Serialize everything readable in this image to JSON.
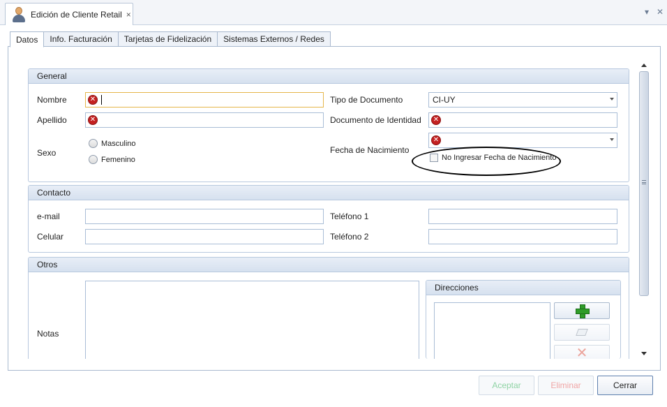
{
  "document_tab": {
    "title": "Edición de Cliente Retail",
    "close_glyph": "×"
  },
  "window_controls": {
    "dropdown_glyph": "▾",
    "close_glyph": "✕"
  },
  "tabs": [
    {
      "label": "Datos",
      "active": true
    },
    {
      "label": "Info. Facturación",
      "active": false
    },
    {
      "label": "Tarjetas de Fidelización",
      "active": false
    },
    {
      "label": "Sistemas Externos / Redes",
      "active": false
    }
  ],
  "general": {
    "header": "General",
    "nombre_label": "Nombre",
    "nombre_value": "",
    "apellido_label": "Apellido",
    "apellido_value": "",
    "sexo_label": "Sexo",
    "sexo_options": [
      "Masculino",
      "Femenino"
    ],
    "tipo_doc_label": "Tipo de Documento",
    "tipo_doc_value": "CI-UY",
    "doc_id_label": "Documento de Identidad",
    "doc_id_value": "",
    "fecha_nac_label": "Fecha de Nacimiento",
    "fecha_nac_value": "",
    "no_fecha_label": "No Ingresar Fecha de Nacimiento",
    "no_fecha_checked": false,
    "error_glyph": "✕"
  },
  "contacto": {
    "header": "Contacto",
    "email_label": "e-mail",
    "celular_label": "Celular",
    "telefono1_label": "Teléfono 1",
    "telefono2_label": "Teléfono 2"
  },
  "otros": {
    "header": "Otros",
    "notas_label": "Notas",
    "direcciones_header": "Direcciones",
    "icons": [
      "add-icon",
      "edit-icon",
      "delete-icon"
    ]
  },
  "buttons": {
    "aceptar": "Aceptar",
    "eliminar": "Eliminar",
    "cerrar": "Cerrar"
  },
  "colors": {
    "accent_border": "#a9b9cf",
    "error": "#c42121",
    "focus": "#e5b64a",
    "add_green": "#2f9d2a"
  }
}
